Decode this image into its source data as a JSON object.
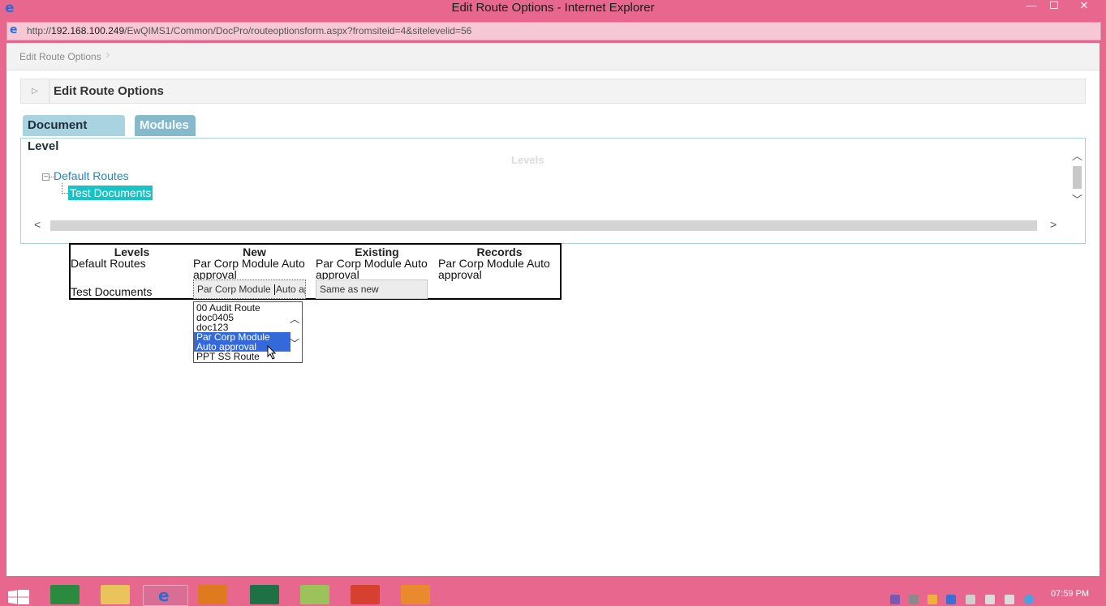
{
  "window": {
    "title": "Edit Route Options - Internet Explorer",
    "minimize": "—",
    "maximize": "☐",
    "close": "✕"
  },
  "address": {
    "prefix": "http://",
    "host": "192.168.100.249",
    "path": "/EwQIMS1/Common/DocPro/routeoptionsform.aspx?fromsiteid=4&sitelevelid=56"
  },
  "breadcrumb": {
    "item": "Edit Route Options"
  },
  "panel": {
    "title": "Edit Route Options",
    "toggle": "▷"
  },
  "tabs": {
    "document_level": "Document Level",
    "modules": "Modules"
  },
  "tree": {
    "header": "Levels",
    "expander": "–",
    "root": "Default Routes",
    "child": "Test Documents"
  },
  "table": {
    "headers": [
      "Levels",
      "New",
      "Existing",
      "Records"
    ],
    "rows": [
      {
        "level": "Default Routes",
        "new": "Par Corp Module Auto approval",
        "existing": "Par Corp Module Auto approval",
        "records": "Par Corp Module Auto approval"
      },
      {
        "level": "Test Documents",
        "new_select_before": "Par Corp Module ",
        "new_select_after": "Auto ap",
        "existing_select": "Same as new"
      }
    ]
  },
  "dropdown": {
    "options": [
      "00 Audit Route",
      "doc0405",
      "doc123",
      "Par Corp Module",
      "Auto approval",
      "PPT SS Route"
    ],
    "selected": "Par Corp Module Auto approval",
    "scroll_up": "︿",
    "scroll_down": "﹀"
  },
  "taskbar": {
    "clock": "07:59 PM"
  },
  "colors": {
    "chrome": "#e8678f",
    "tab_active": "#a9d3e0",
    "tab_inactive": "#86b9cc",
    "tree_link": "#1e87c2",
    "tree_selected_bg": "#16c3c6",
    "option_selected": "#3369d8"
  }
}
